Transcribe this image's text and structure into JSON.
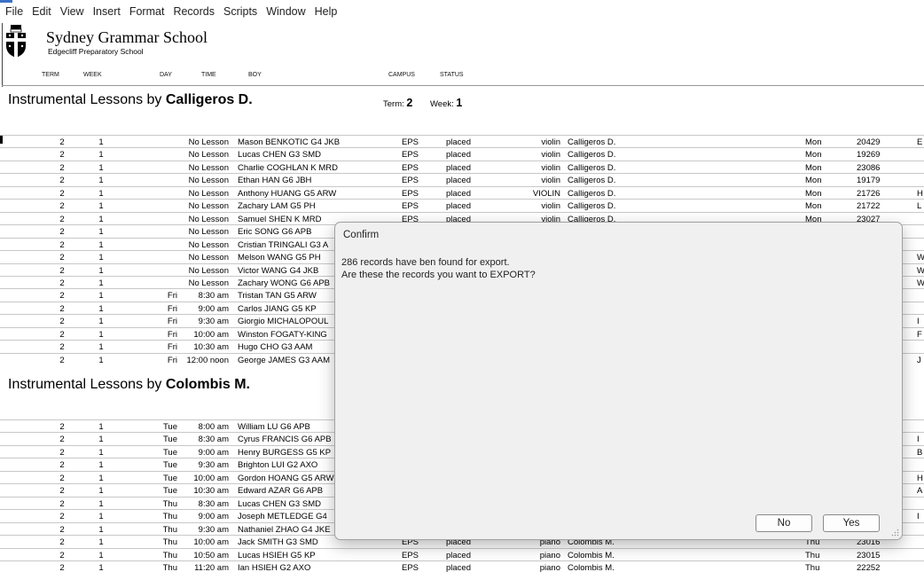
{
  "menu": [
    "File",
    "Edit",
    "View",
    "Insert",
    "Format",
    "Records",
    "Scripts",
    "Window",
    "Help"
  ],
  "header": {
    "school_name": "Sydney Grammar School",
    "school_sub": "Edgecliff Preparatory School",
    "logo_icon": "school-crest-icon",
    "columns": {
      "term": "TERM",
      "week": "WEEK",
      "day": "DAY",
      "time": "TIME",
      "boy": "BOY",
      "campus": "CAMPUS",
      "status": "STATUS"
    }
  },
  "section1": {
    "prefix": "Instrumental Lessons by ",
    "teacher": "Calligeros D.",
    "term_label": "Term: ",
    "term": "2",
    "week_label": "Week: ",
    "week": "1",
    "rows": [
      {
        "term": "2",
        "week": "1",
        "day": "",
        "time": "No Lesson",
        "boy": "Mason BENKOTIC G4 JKB",
        "campus": "EPS",
        "status": "placed",
        "inst": "violin",
        "teacher": "Calligeros D.",
        "tday": "Mon",
        "code": "20429",
        "extra": "E"
      },
      {
        "term": "2",
        "week": "1",
        "day": "",
        "time": "No Lesson",
        "boy": "Lucas CHEN G3 SMD",
        "campus": "EPS",
        "status": "placed",
        "inst": "violin",
        "teacher": "Calligeros D.",
        "tday": "Mon",
        "code": "19269",
        "extra": ""
      },
      {
        "term": "2",
        "week": "1",
        "day": "",
        "time": "No Lesson",
        "boy": "Charlie COGHLAN K MRD",
        "campus": "EPS",
        "status": "placed",
        "inst": "violin",
        "teacher": "Calligeros D.",
        "tday": "Mon",
        "code": "23086",
        "extra": ""
      },
      {
        "term": "2",
        "week": "1",
        "day": "",
        "time": "No Lesson",
        "boy": "Ethan HAN G6 JBH",
        "campus": "EPS",
        "status": "placed",
        "inst": "violin",
        "teacher": "Calligeros D.",
        "tday": "Mon",
        "code": "19179",
        "extra": ""
      },
      {
        "term": "2",
        "week": "1",
        "day": "",
        "time": "No Lesson",
        "boy": "Anthony HUANG G5 ARW",
        "campus": "EPS",
        "status": "placed",
        "inst": "VIOLIN",
        "teacher": "Calligeros D.",
        "tday": "Mon",
        "code": "21726",
        "extra": "H"
      },
      {
        "term": "2",
        "week": "1",
        "day": "",
        "time": "No Lesson",
        "boy": "Zachary LAM G5 PH",
        "campus": "EPS",
        "status": "placed",
        "inst": "violin",
        "teacher": "Calligeros D.",
        "tday": "Mon",
        "code": "21722",
        "extra": "L"
      },
      {
        "term": "2",
        "week": "1",
        "day": "",
        "time": "No Lesson",
        "boy": "Samuel SHEN K MRD",
        "campus": "EPS",
        "status": "placed",
        "inst": "violin",
        "teacher": "Calligeros D.",
        "tday": "Mon",
        "code": "23027",
        "extra": ""
      },
      {
        "term": "2",
        "week": "1",
        "day": "",
        "time": "No Lesson",
        "boy": "Eric SONG G6 APB",
        "campus": "",
        "status": "",
        "inst": "",
        "teacher": "",
        "tday": "",
        "code": "",
        "extra": ""
      },
      {
        "term": "2",
        "week": "1",
        "day": "",
        "time": "No Lesson",
        "boy": "Cristian TRINGALI G3 A",
        "campus": "",
        "status": "",
        "inst": "",
        "teacher": "",
        "tday": "",
        "code": "",
        "extra": ""
      },
      {
        "term": "2",
        "week": "1",
        "day": "",
        "time": "No Lesson",
        "boy": "Melson WANG G5 PH",
        "campus": "",
        "status": "",
        "inst": "",
        "teacher": "",
        "tday": "",
        "code": "",
        "extra": "W"
      },
      {
        "term": "2",
        "week": "1",
        "day": "",
        "time": "No Lesson",
        "boy": "Victor WANG G4 JKB",
        "campus": "",
        "status": "",
        "inst": "",
        "teacher": "",
        "tday": "",
        "code": "",
        "extra": "W"
      },
      {
        "term": "2",
        "week": "1",
        "day": "",
        "time": "No Lesson",
        "boy": "Zachary WONG G6 APB",
        "campus": "",
        "status": "",
        "inst": "",
        "teacher": "",
        "tday": "",
        "code": "",
        "extra": "W"
      },
      {
        "term": "2",
        "week": "1",
        "day": "Fri",
        "time": "8:30 am",
        "boy": "Tristan TAN G5 ARW",
        "campus": "",
        "status": "",
        "inst": "",
        "teacher": "",
        "tday": "",
        "code": "",
        "extra": ""
      },
      {
        "term": "2",
        "week": "1",
        "day": "Fri",
        "time": "9:00 am",
        "boy": "Carlos JIANG G5 KP",
        "campus": "",
        "status": "",
        "inst": "",
        "teacher": "",
        "tday": "",
        "code": "",
        "extra": ""
      },
      {
        "term": "2",
        "week": "1",
        "day": "Fri",
        "time": "9:30 am",
        "boy": "Giorgio MICHALOPOUL",
        "campus": "",
        "status": "",
        "inst": "",
        "teacher": "",
        "tday": "",
        "code": "",
        "extra": "I"
      },
      {
        "term": "2",
        "week": "1",
        "day": "Fri",
        "time": "10:00 am",
        "boy": "Winston FOGATY-KING",
        "campus": "",
        "status": "",
        "inst": "",
        "teacher": "",
        "tday": "",
        "code": "",
        "extra": "F"
      },
      {
        "term": "2",
        "week": "1",
        "day": "Fri",
        "time": "10:30 am",
        "boy": "Hugo CHO G3 AAM",
        "campus": "",
        "status": "",
        "inst": "",
        "teacher": "",
        "tday": "",
        "code": "",
        "extra": ""
      },
      {
        "term": "2",
        "week": "1",
        "day": "Fri",
        "time": "12:00 noon",
        "boy": "George JAMES G3 AAM",
        "campus": "",
        "status": "",
        "inst": "",
        "teacher": "",
        "tday": "",
        "code": "",
        "extra": "J"
      }
    ]
  },
  "section2": {
    "prefix": "Instrumental Lessons by ",
    "teacher": "Colombis M.",
    "rows": [
      {
        "term": "2",
        "week": "1",
        "day": "Tue",
        "time": "8:00 am",
        "boy": "William LU G6 APB",
        "campus": "",
        "status": "",
        "inst": "",
        "teacher": "",
        "tday": "",
        "code": "",
        "extra": ""
      },
      {
        "term": "2",
        "week": "1",
        "day": "Tue",
        "time": "8:30 am",
        "boy": "Cyrus FRANCIS G6 APB",
        "campus": "",
        "status": "",
        "inst": "",
        "teacher": "",
        "tday": "",
        "code": "",
        "extra": "I"
      },
      {
        "term": "2",
        "week": "1",
        "day": "Tue",
        "time": "9:00 am",
        "boy": "Henry BURGESS G5 KP",
        "campus": "",
        "status": "",
        "inst": "",
        "teacher": "",
        "tday": "",
        "code": "",
        "extra": "B"
      },
      {
        "term": "2",
        "week": "1",
        "day": "Tue",
        "time": "9:30 am",
        "boy": "Brighton LUI G2 AXO",
        "campus": "",
        "status": "",
        "inst": "",
        "teacher": "",
        "tday": "",
        "code": "",
        "extra": ""
      },
      {
        "term": "2",
        "week": "1",
        "day": "Tue",
        "time": "10:00 am",
        "boy": "Gordon HOANG G5 ARW",
        "campus": "",
        "status": "",
        "inst": "",
        "teacher": "",
        "tday": "",
        "code": "",
        "extra": "H"
      },
      {
        "term": "2",
        "week": "1",
        "day": "Tue",
        "time": "10:30 am",
        "boy": "Edward AZAR G6 APB",
        "campus": "",
        "status": "",
        "inst": "",
        "teacher": "",
        "tday": "",
        "code": "",
        "extra": "A"
      },
      {
        "term": "2",
        "week": "1",
        "day": "Thu",
        "time": "8:30 am",
        "boy": "Lucas CHEN G3 SMD",
        "campus": "",
        "status": "",
        "inst": "",
        "teacher": "",
        "tday": "",
        "code": "",
        "extra": ""
      },
      {
        "term": "2",
        "week": "1",
        "day": "Thu",
        "time": "9:00 am",
        "boy": "Joseph METLEDGE G4",
        "campus": "",
        "status": "",
        "inst": "",
        "teacher": "",
        "tday": "",
        "code": "",
        "extra": "I"
      },
      {
        "term": "2",
        "week": "1",
        "day": "Thu",
        "time": "9:30 am",
        "boy": "Nathaniel ZHAO G4 JKE",
        "campus": "",
        "status": "",
        "inst": "",
        "teacher": "",
        "tday": "",
        "code": "",
        "extra": ""
      },
      {
        "term": "2",
        "week": "1",
        "day": "Thu",
        "time": "10:00 am",
        "boy": "Jack SMITH G3 SMD",
        "campus": "EPS",
        "status": "placed",
        "inst": "piano",
        "teacher": "Colombis M.",
        "tday": "Thu",
        "code": "23016",
        "extra": ""
      },
      {
        "term": "2",
        "week": "1",
        "day": "Thu",
        "time": "10:50 am",
        "boy": "Lucas HSIEH G5 KP",
        "campus": "EPS",
        "status": "placed",
        "inst": "piano",
        "teacher": "Colombis M.",
        "tday": "Thu",
        "code": "23015",
        "extra": ""
      },
      {
        "term": "2",
        "week": "1",
        "day": "Thu",
        "time": "11:20 am",
        "boy": "Ian HSIEH G2 AXO",
        "campus": "EPS",
        "status": "placed",
        "inst": "piano",
        "teacher": "Colombis M.",
        "tday": "Thu",
        "code": "22252",
        "extra": ""
      }
    ]
  },
  "dialog": {
    "title": "Confirm",
    "line1": "286 records have ben found for export.",
    "line2": "Are these the records you want to EXPORT?",
    "no_label": "No",
    "yes_label": "Yes"
  }
}
